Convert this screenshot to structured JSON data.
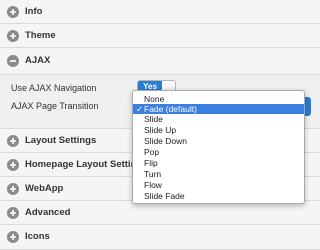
{
  "sections": {
    "info": "Info",
    "theme": "Theme",
    "ajax": "AJAX",
    "layout": "Layout Settings",
    "homepage": "Homepage Layout Settings",
    "webapp": "WebApp",
    "advanced": "Advanced",
    "icons": "Icons"
  },
  "ajax_panel": {
    "nav_label": "Use AJAX Navigation",
    "toggle_value": "Yes",
    "transition_label": "AJAX Page Transition"
  },
  "transition_select": {
    "selected": "Fade (default)",
    "check": "✓",
    "options": [
      "None",
      "Fade (default)",
      "Slide",
      "Slide Up",
      "Slide Down",
      "Pop",
      "Flip",
      "Turn",
      "Flow",
      "Slide Fade"
    ]
  },
  "colors": {
    "accent": "#2a7ccf",
    "highlight": "#3b7fe0",
    "icon": "#8a8a8a"
  }
}
